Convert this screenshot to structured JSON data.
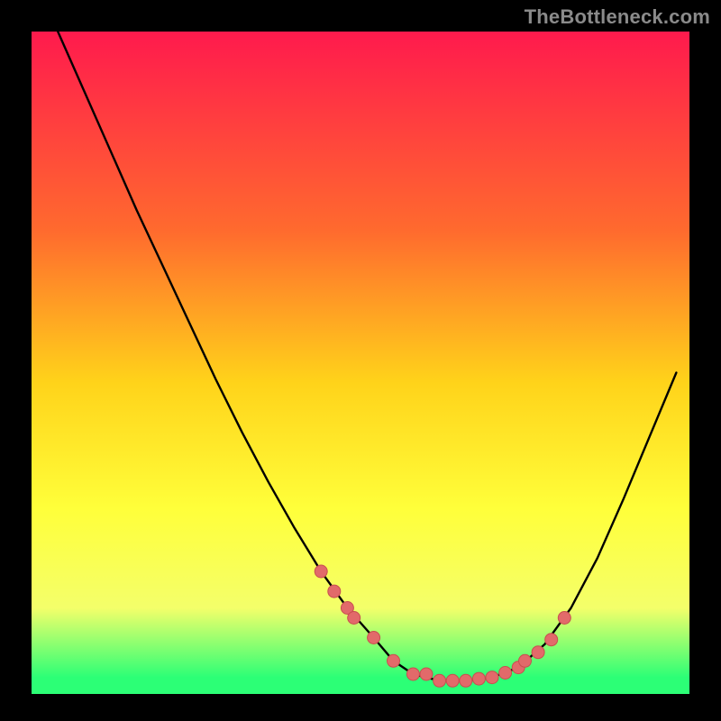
{
  "watermark": "TheBottleneck.com",
  "colors": {
    "bg": "#000000",
    "grad_top": "#ff1a4d",
    "grad_mid1": "#ff6a2e",
    "grad_mid2": "#ffd31a",
    "grad_mid3": "#ffff3a",
    "grad_mid4": "#f4ff6a",
    "grad_bottom": "#2cff76",
    "curve": "#000000",
    "marker_fill": "#e26a6a",
    "marker_stroke": "#c84f4f"
  },
  "chart_data": {
    "type": "line",
    "title": "",
    "xlabel": "",
    "ylabel": "",
    "xlim": [
      0,
      100
    ],
    "ylim": [
      0,
      100
    ],
    "series": [
      {
        "name": "bottleneck-curve",
        "x": [
          4,
          8,
          12,
          16,
          20,
          24,
          28,
          32,
          36,
          40,
          44,
          48,
          52,
          55,
          58,
          62,
          66,
          70,
          74,
          78,
          82,
          86,
          90,
          94,
          98
        ],
        "y": [
          100,
          91,
          82,
          73,
          64.5,
          56,
          47.5,
          39.5,
          32,
          25,
          18.5,
          13,
          8.5,
          5,
          3,
          2,
          2,
          2.5,
          4,
          7.5,
          13,
          20.5,
          29.5,
          39,
          48.5
        ]
      }
    ],
    "markers": {
      "name": "highlighted-points",
      "x": [
        44,
        46,
        48,
        49,
        52,
        55,
        58,
        60,
        62,
        64,
        66,
        68,
        70,
        72,
        74,
        75,
        77,
        79,
        81
      ],
      "y": [
        18.5,
        15.5,
        13,
        11.5,
        8.5,
        5,
        3,
        3,
        2,
        2,
        2,
        2.3,
        2.5,
        3.2,
        4,
        5,
        6.3,
        8.2,
        11.5
      ]
    }
  }
}
